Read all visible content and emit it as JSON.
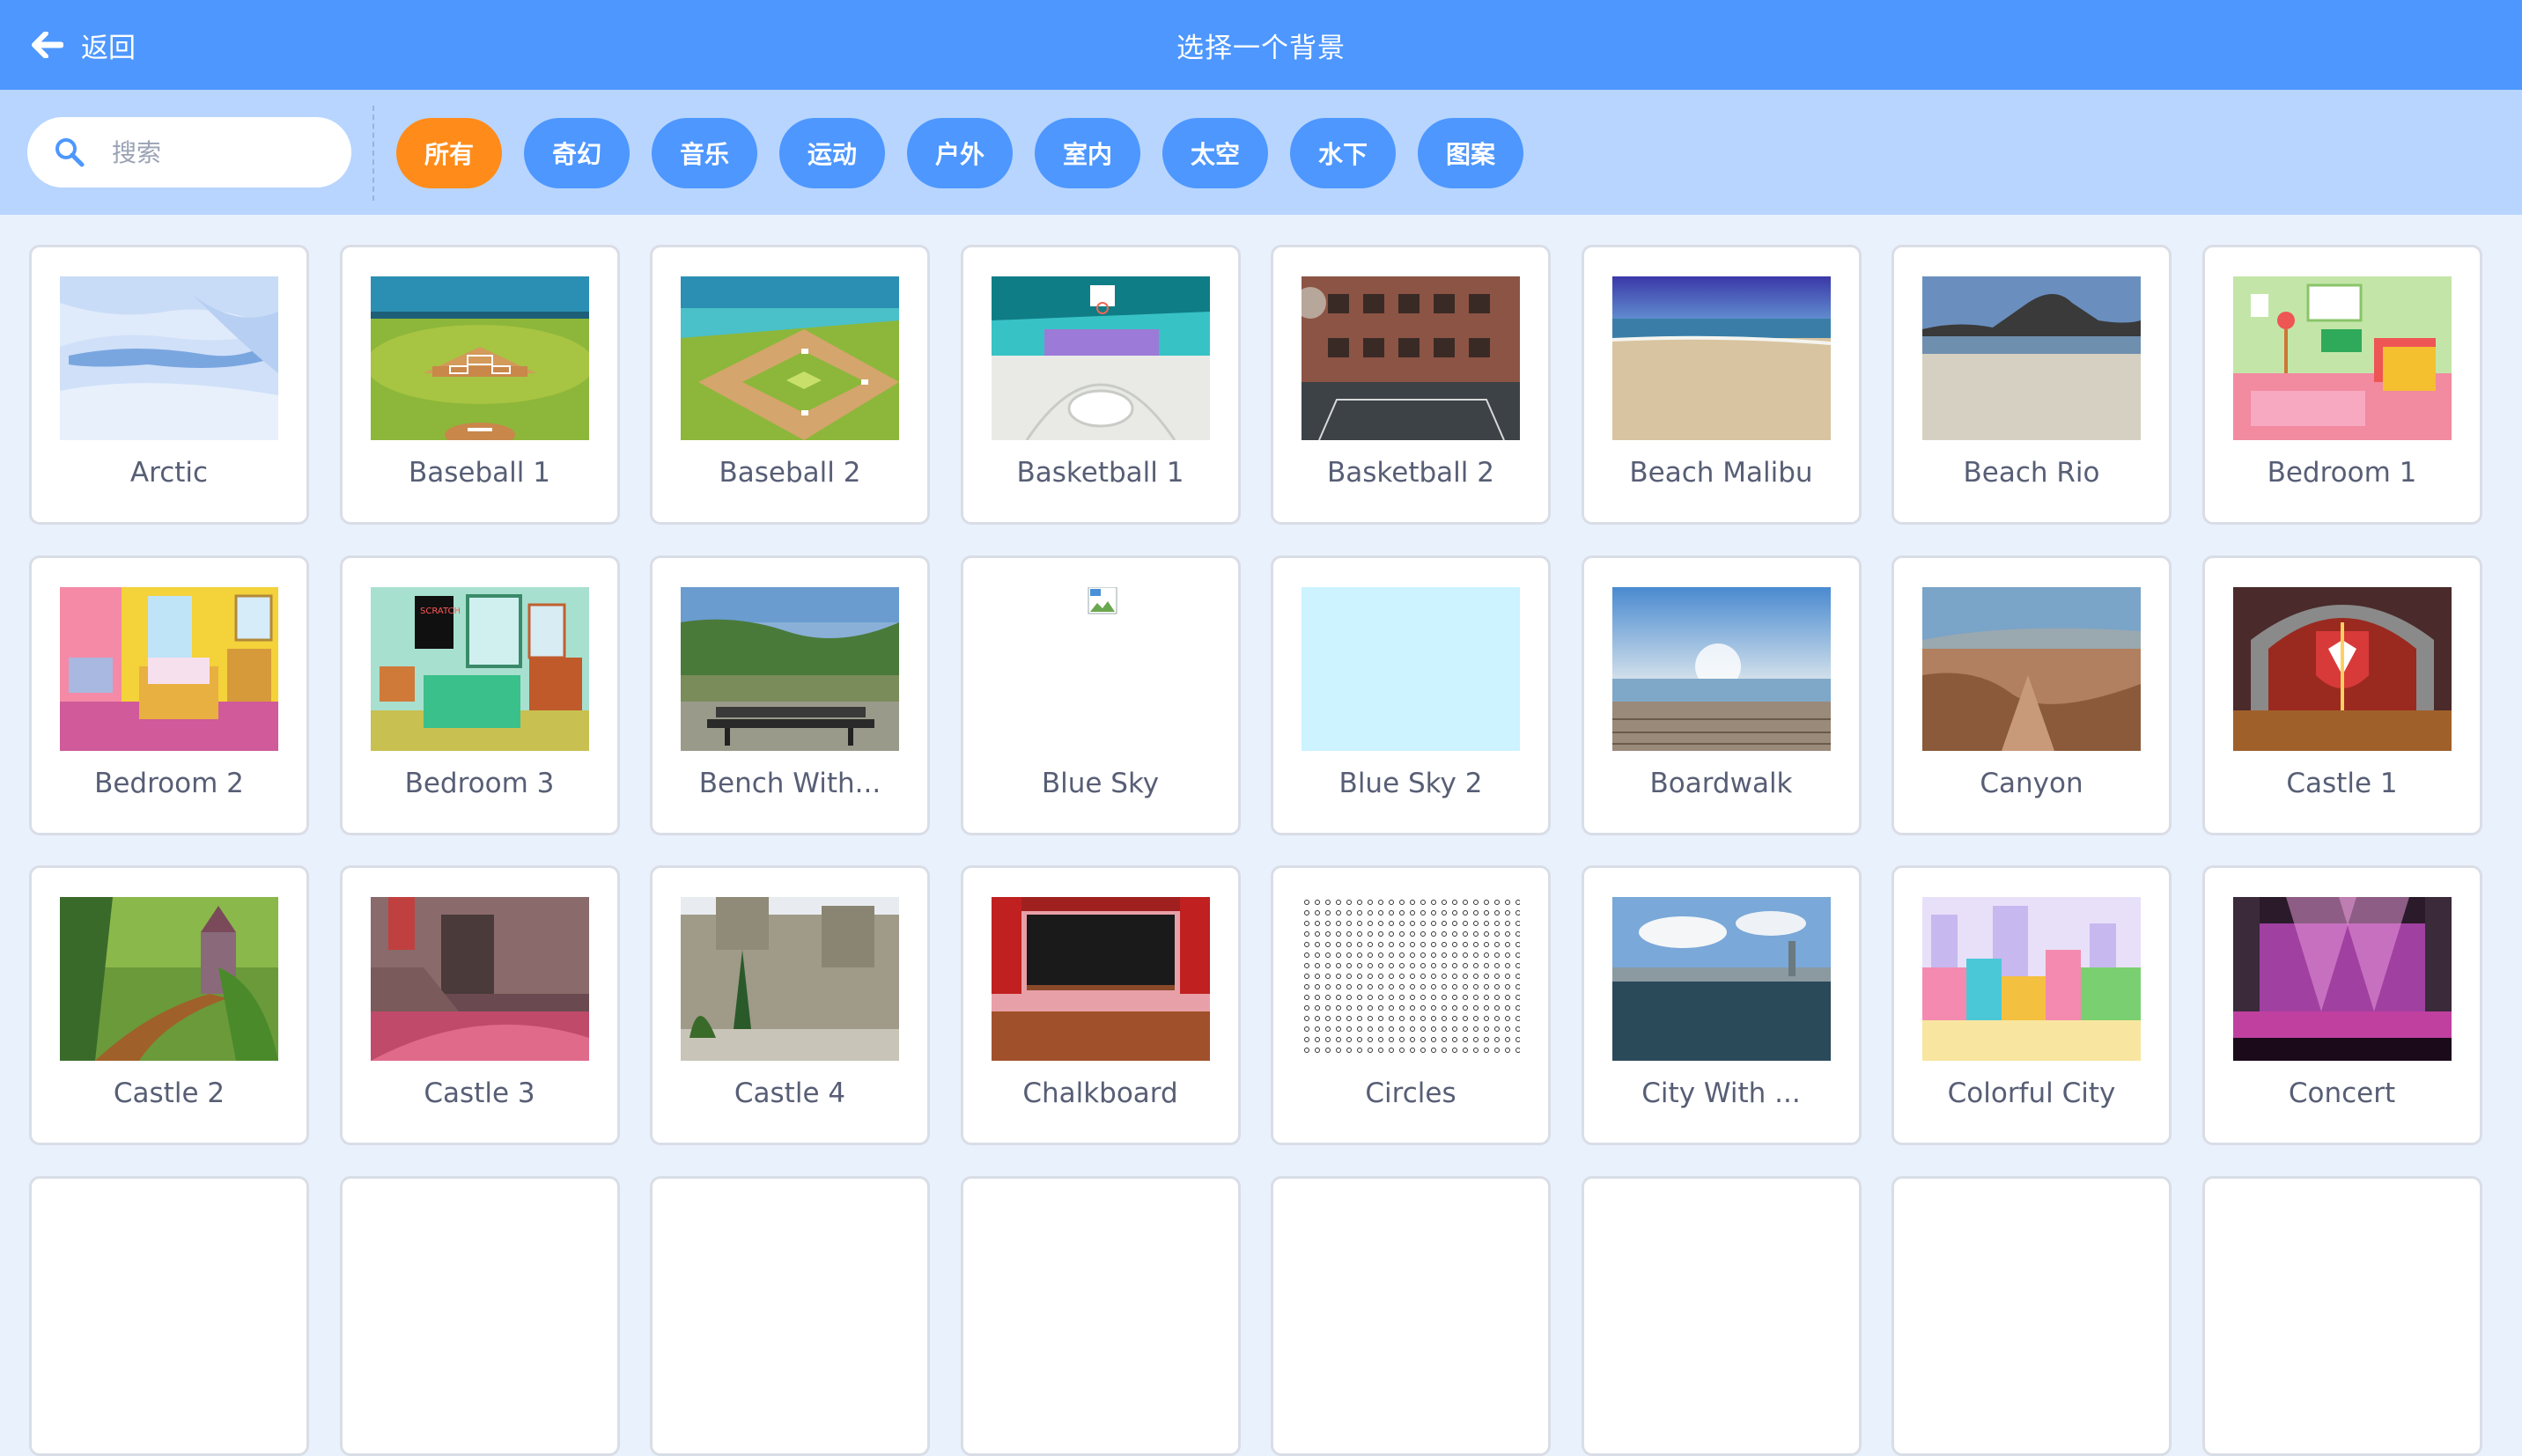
{
  "header": {
    "back_label": "返回",
    "title": "选择一个背景"
  },
  "search": {
    "placeholder": "搜索",
    "value": ""
  },
  "tags": [
    {
      "label": "所有",
      "active": true
    },
    {
      "label": "奇幻",
      "active": false
    },
    {
      "label": "音乐",
      "active": false
    },
    {
      "label": "运动",
      "active": false
    },
    {
      "label": "户外",
      "active": false
    },
    {
      "label": "室内",
      "active": false
    },
    {
      "label": "太空",
      "active": false
    },
    {
      "label": "水下",
      "active": false
    },
    {
      "label": "图案",
      "active": false
    }
  ],
  "colors": {
    "header_bg": "#4d97ff",
    "filter_bg": "#b8d5ff",
    "active_tag": "#ff8c1a",
    "tag": "#4d97ff",
    "label_text": "#575e75"
  },
  "backdrops": [
    {
      "name": "Arctic",
      "thumb": "arctic"
    },
    {
      "name": "Baseball 1",
      "thumb": "baseball1"
    },
    {
      "name": "Baseball 2",
      "thumb": "baseball2"
    },
    {
      "name": "Basketball 1",
      "thumb": "basketball1"
    },
    {
      "name": "Basketball 2",
      "thumb": "basketball2"
    },
    {
      "name": "Beach Malibu",
      "thumb": "beach-malibu"
    },
    {
      "name": "Beach Rio",
      "thumb": "beach-rio"
    },
    {
      "name": "Bedroom 1",
      "thumb": "bedroom1"
    },
    {
      "name": "Bedroom 2",
      "thumb": "bedroom2"
    },
    {
      "name": "Bedroom 3",
      "thumb": "bedroom3"
    },
    {
      "name": "Bench With...",
      "thumb": "bench"
    },
    {
      "name": "Blue Sky",
      "thumb": "broken-image"
    },
    {
      "name": "Blue Sky 2",
      "thumb": "blue-sky2"
    },
    {
      "name": "Boardwalk",
      "thumb": "boardwalk"
    },
    {
      "name": "Canyon",
      "thumb": "canyon"
    },
    {
      "name": "Castle 1",
      "thumb": "castle1"
    },
    {
      "name": "Castle 2",
      "thumb": "castle2"
    },
    {
      "name": "Castle 3",
      "thumb": "castle3"
    },
    {
      "name": "Castle 4",
      "thumb": "castle4"
    },
    {
      "name": "Chalkboard",
      "thumb": "chalkboard"
    },
    {
      "name": "Circles",
      "thumb": "circles"
    },
    {
      "name": "City With ...",
      "thumb": "city"
    },
    {
      "name": "Colorful City",
      "thumb": "colorful-city"
    },
    {
      "name": "Concert",
      "thumb": "concert"
    }
  ]
}
